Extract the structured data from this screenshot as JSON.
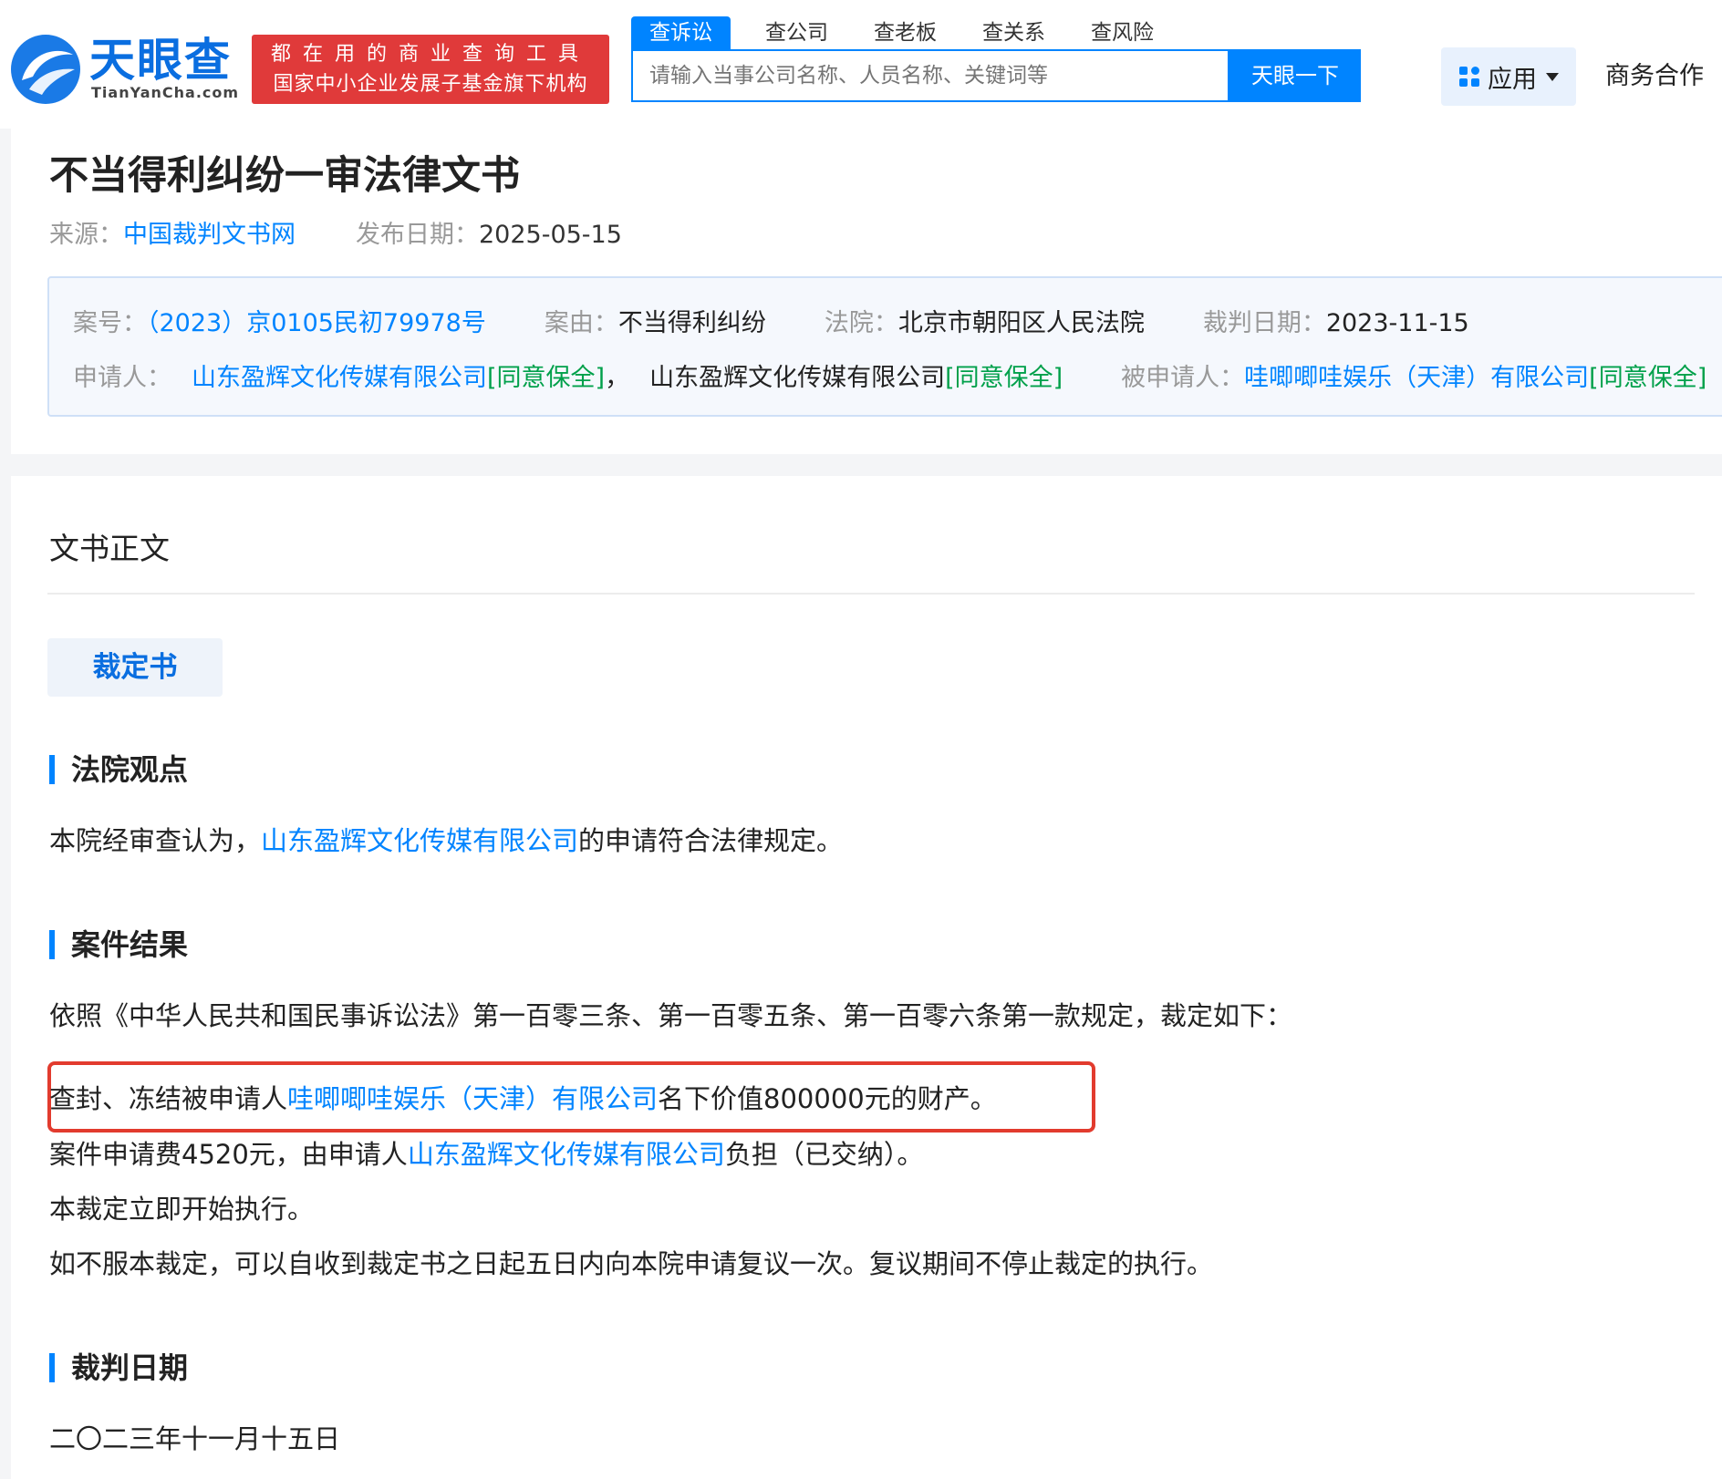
{
  "header": {
    "logo_text": "天眼查",
    "logo_sub": "TianYanCha.com",
    "slogan_line1": "都在用的商业查询工具",
    "slogan_line2": "国家中小企业发展子基金旗下机构",
    "search_tabs": [
      "查诉讼",
      "查公司",
      "查老板",
      "查关系",
      "查风险"
    ],
    "search_placeholder": "请输入当事公司名称、人员名称、关键词等",
    "search_button": "天眼一下",
    "app_button": "应用",
    "biz_link": "商务合作"
  },
  "doc": {
    "title": "不当得利纠纷一审法律文书",
    "source_label": "来源：",
    "source_value": "中国裁判文书网",
    "publish_label": "发布日期：",
    "publish_value": "2025-05-15"
  },
  "case_info": {
    "case_no_label": "案号：",
    "case_no": "（2023）京0105民初79978号",
    "cause_label": "案由：",
    "cause": "不当得利纠纷",
    "court_label": "法院：",
    "court": "北京市朝阳区人民法院",
    "judge_date_label": "裁判日期：",
    "judge_date": "2023-11-15",
    "applicant_label": "申请人：",
    "applicant_1": "山东盈辉文化传媒有限公司",
    "applicant_1_tag": "[同意保全]",
    "separator": "，",
    "applicant_2": "山东盈辉文化传媒有限公司",
    "applicant_2_tag": "[同意保全]",
    "respondent_label": "被申请人：",
    "respondent": "哇唧唧哇娱乐（天津）有限公司",
    "respondent_tag": "[同意保全]"
  },
  "body": {
    "heading": "文书正文",
    "doc_type": "裁定书",
    "section_opinion": "法院观点",
    "opinion_pre": "本院经审查认为，",
    "opinion_company": "山东盈辉文化传媒有限公司",
    "opinion_post": "的申请符合法律规定。",
    "section_result": "案件结果",
    "result_intro": "依照《中华人民共和国民事诉讼法》第一百零三条、第一百零五条、第一百零六条第一款规定，裁定如下：",
    "result_1_pre": "查封、冻结被申请人",
    "result_1_company": "哇唧唧哇娱乐（天津）有限公司",
    "result_1_post": "名下价值800000元的财产。",
    "result_2_pre": "案件申请费4520元，由申请人",
    "result_2_company": "山东盈辉文化传媒有限公司",
    "result_2_post": "负担（已交纳）。",
    "result_3": "本裁定立即开始执行。",
    "result_4": "如不服本裁定，可以自收到裁定书之日起五日内向本院申请复议一次。复议期间不停止裁定的执行。",
    "section_date": "裁判日期",
    "date_text": "二〇二三年十一月十五日"
  },
  "colors": {
    "brand_blue": "#0084ff",
    "slogan_red": "#e03a3a",
    "tag_green": "#00a04a",
    "highlight_red": "#e23b2e"
  },
  "icons": [
    "tianyancha-logo-icon",
    "app-grid-icon",
    "caret-down-icon"
  ]
}
